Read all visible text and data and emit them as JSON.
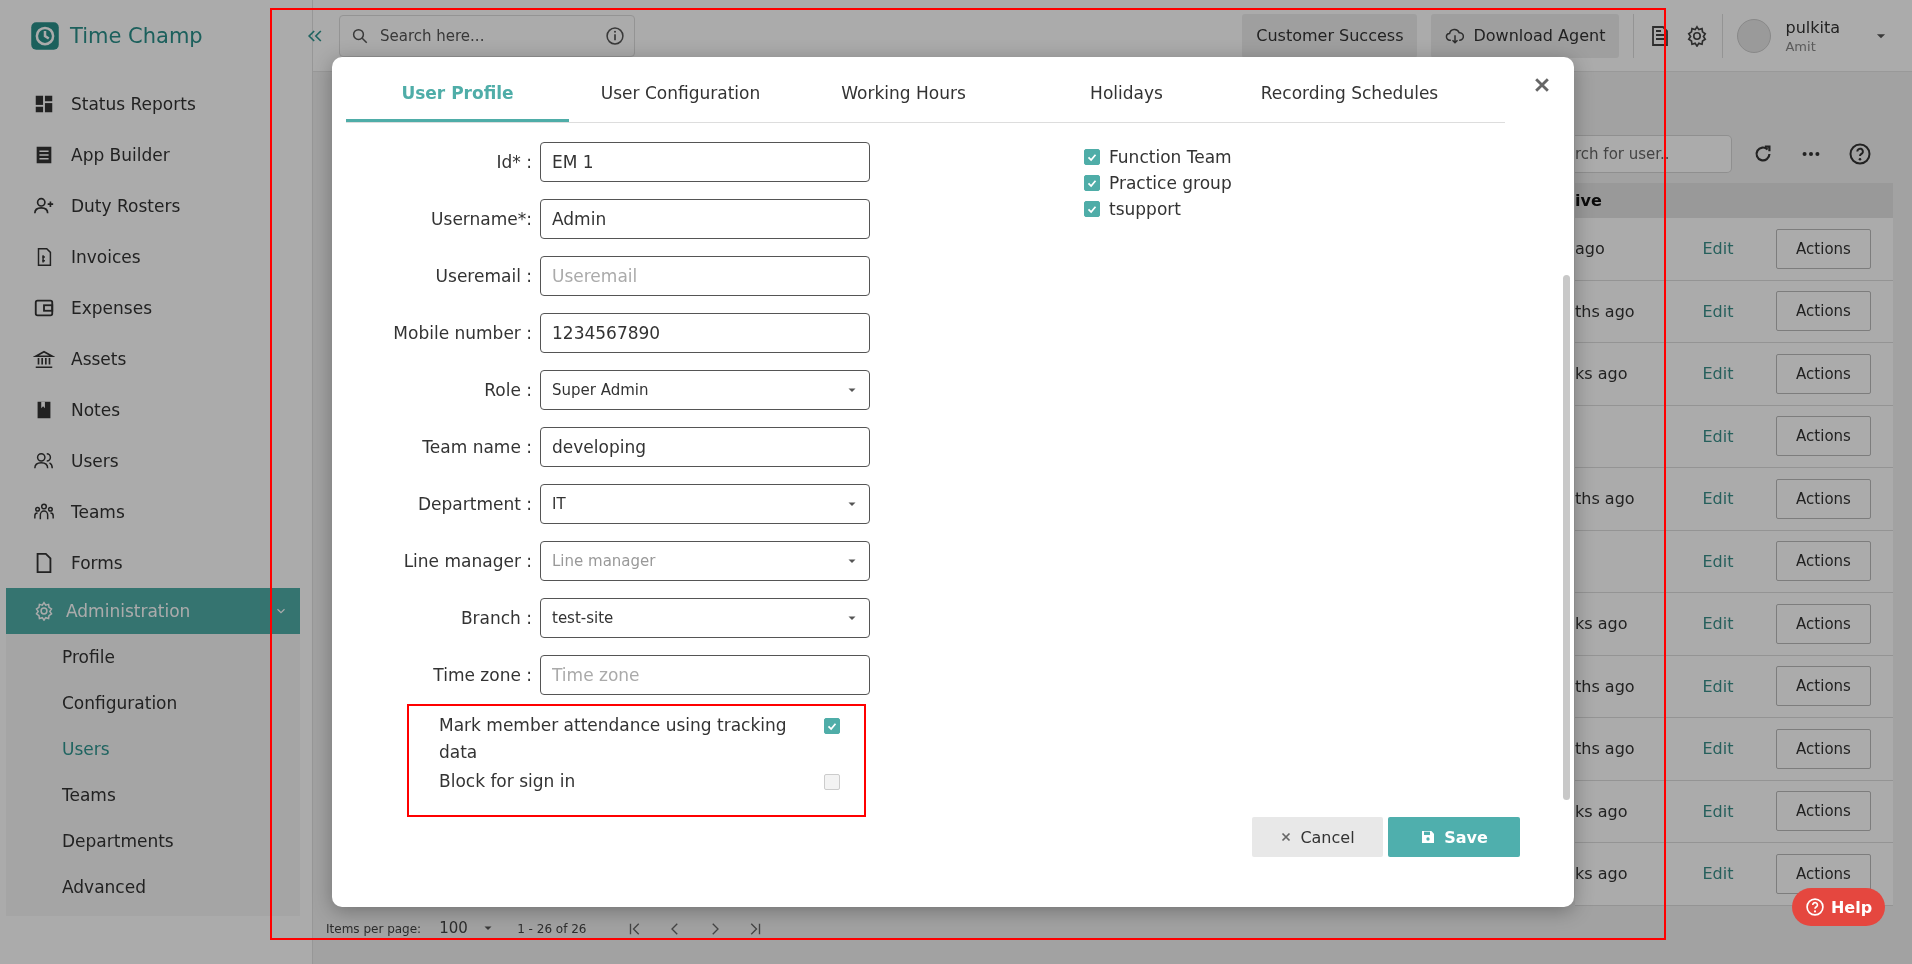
{
  "sidebar": {
    "brand": "Time Champ",
    "items": [
      {
        "label": "Status Reports"
      },
      {
        "label": "App Builder"
      },
      {
        "label": "Duty Rosters"
      },
      {
        "label": "Invoices"
      },
      {
        "label": "Expenses"
      },
      {
        "label": "Assets"
      },
      {
        "label": "Notes"
      },
      {
        "label": "Users"
      },
      {
        "label": "Teams"
      },
      {
        "label": "Forms"
      }
    ],
    "admin": {
      "label": "Administration",
      "expanded": true,
      "children": [
        {
          "label": "Profile",
          "selected": false
        },
        {
          "label": "Configuration",
          "selected": false
        },
        {
          "label": "Users",
          "selected": true
        },
        {
          "label": "Teams",
          "selected": false
        },
        {
          "label": "Departments",
          "selected": false
        },
        {
          "label": "Advanced",
          "selected": false
        }
      ]
    }
  },
  "topbar": {
    "search_placeholder": "Search here...",
    "buttons": [
      {
        "label": "Customer Success",
        "kind": "plain"
      },
      {
        "label": "Download Agent",
        "kind": "download"
      }
    ],
    "user": {
      "name": "pulkita",
      "subtitle": "Amit"
    }
  },
  "users_table": {
    "search_value": "rch for user..",
    "column_header": "ive",
    "rows": [
      {
        "column_1": "ago",
        "edit": "Edit",
        "action": "Actions"
      },
      {
        "column_1": "ths ago",
        "edit": "Edit",
        "action": "Actions"
      },
      {
        "column_1": "ks ago",
        "edit": "Edit",
        "action": "Actions"
      },
      {
        "edit": "Edit",
        "action": "Actions"
      },
      {
        "column_1": "ths ago",
        "edit": "Edit",
        "action": "Actions"
      },
      {
        "edit": "Edit",
        "action": "Actions"
      },
      {
        "column_1": "ks ago",
        "edit": "Edit",
        "action": "Actions"
      },
      {
        "column_1": "ths ago",
        "edit": "Edit",
        "action": "Actions"
      },
      {
        "column_1": "ths ago",
        "edit": "Edit",
        "action": "Actions"
      },
      {
        "column_1": "ks ago",
        "edit": "Edit",
        "action": "Actions"
      },
      {
        "column_1": "ks ago",
        "edit": "Edit",
        "action": "Actions"
      }
    ]
  },
  "pagination": {
    "label": "Items per page:",
    "page_size": "100",
    "range": "1 - 26 of 26"
  },
  "help_button": "Help",
  "modal": {
    "tabs": [
      {
        "label": "User Profile",
        "selected": true
      },
      {
        "label": "User Configuration",
        "selected": false
      },
      {
        "label": "Working Hours",
        "selected": false
      },
      {
        "label": "Holidays",
        "selected": false
      },
      {
        "label": "Recording Schedules",
        "selected": false
      }
    ],
    "fields": [
      {
        "label": "Id*  :",
        "kind": "text",
        "value": "EM 1"
      },
      {
        "label": "Username*:",
        "kind": "text",
        "value": "Admin"
      },
      {
        "label": "Useremail :",
        "kind": "text",
        "placeholder": "Useremail"
      },
      {
        "label": "Mobile number :",
        "kind": "text",
        "value": "1234567890"
      },
      {
        "label": "Role :",
        "kind": "select",
        "value": "Super Admin"
      },
      {
        "label": "Team name :",
        "kind": "text",
        "value": "developing"
      },
      {
        "label": "Department :",
        "kind": "select",
        "value": "IT"
      },
      {
        "label": "Line manager :",
        "kind": "select",
        "placeholder": "Line manager"
      },
      {
        "label": "Branch :",
        "kind": "select",
        "value": "test-site"
      },
      {
        "label": "Time zone :",
        "kind": "text",
        "placeholder": "Time zone"
      }
    ],
    "groups": [
      {
        "label": "Function Team",
        "checked": true
      },
      {
        "label": "Practice group",
        "checked": true
      },
      {
        "label": "tsupport",
        "checked": true
      }
    ],
    "options": [
      {
        "label": "Mark member attendance using tracking data",
        "checked": true
      },
      {
        "label": "Block for sign in",
        "checked": false
      }
    ],
    "cancel": "Cancel",
    "save": "Save"
  }
}
